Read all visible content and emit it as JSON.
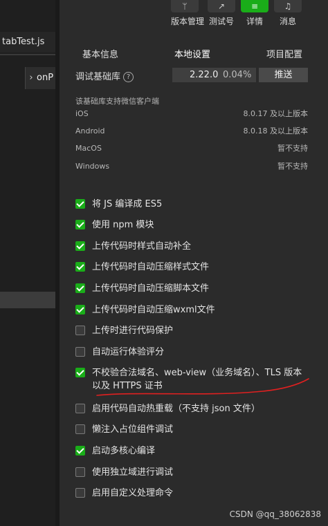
{
  "editor": {
    "file_tab": "tabTest.js",
    "outline_label": "onP",
    "outline_chevron": "chevron-right-icon"
  },
  "toolbar": {
    "buttons": [
      {
        "label": "版本管理",
        "icon": "branch-icon",
        "glyph": "ᛘ"
      },
      {
        "label": "测试号",
        "icon": "external-link-icon",
        "glyph": "↗"
      },
      {
        "label": "详情",
        "icon": "menu-icon",
        "glyph": "≡"
      },
      {
        "label": "消息",
        "icon": "bell-icon",
        "glyph": "♫"
      }
    ],
    "active_color": "#1aad19"
  },
  "tabs": [
    "基本信息",
    "本地设置",
    "项目配置"
  ],
  "base_library": {
    "label": "调试基础库",
    "help_icon": "?",
    "version": "2.22.0",
    "usage": "0.04%",
    "push_label": "推送"
  },
  "client_support": {
    "hint": "该基础库支持微信客户端",
    "rows": [
      {
        "name": "iOS",
        "value": "8.0.17 及以上版本"
      },
      {
        "name": "Android",
        "value": "8.0.18 及以上版本"
      },
      {
        "name": "MacOS",
        "value": "暂不支持"
      },
      {
        "name": "Windows",
        "value": "暂不支持"
      }
    ]
  },
  "options": [
    {
      "label": "将 JS 编译成 ES5",
      "checked": true
    },
    {
      "label": "使用 npm 模块",
      "checked": true
    },
    {
      "label": "上传代码时样式自动补全",
      "checked": true
    },
    {
      "label": "上传代码时自动压缩样式文件",
      "checked": true
    },
    {
      "label": "上传代码时自动压缩脚本文件",
      "checked": true
    },
    {
      "label": "上传代码时自动压缩wxml文件",
      "checked": true
    },
    {
      "label": "上传时进行代码保护",
      "checked": false
    },
    {
      "label": "自动运行体验评分",
      "checked": false
    },
    {
      "label": "不校验合法域名、web-view（业务域名）、TLS 版本以及 HTTPS 证书",
      "checked": true
    },
    {
      "label": "启用代码自动热重载（不支持 json 文件）",
      "checked": false
    },
    {
      "label": "懒注入占位组件调试",
      "checked": false
    },
    {
      "label": "启动多核心编译",
      "checked": true
    },
    {
      "label": "使用独立域进行调试",
      "checked": false
    },
    {
      "label": "启用自定义处理命令",
      "checked": false
    }
  ],
  "watermark": "CSDN @qq_38062838",
  "annotation_color": "#e02020"
}
